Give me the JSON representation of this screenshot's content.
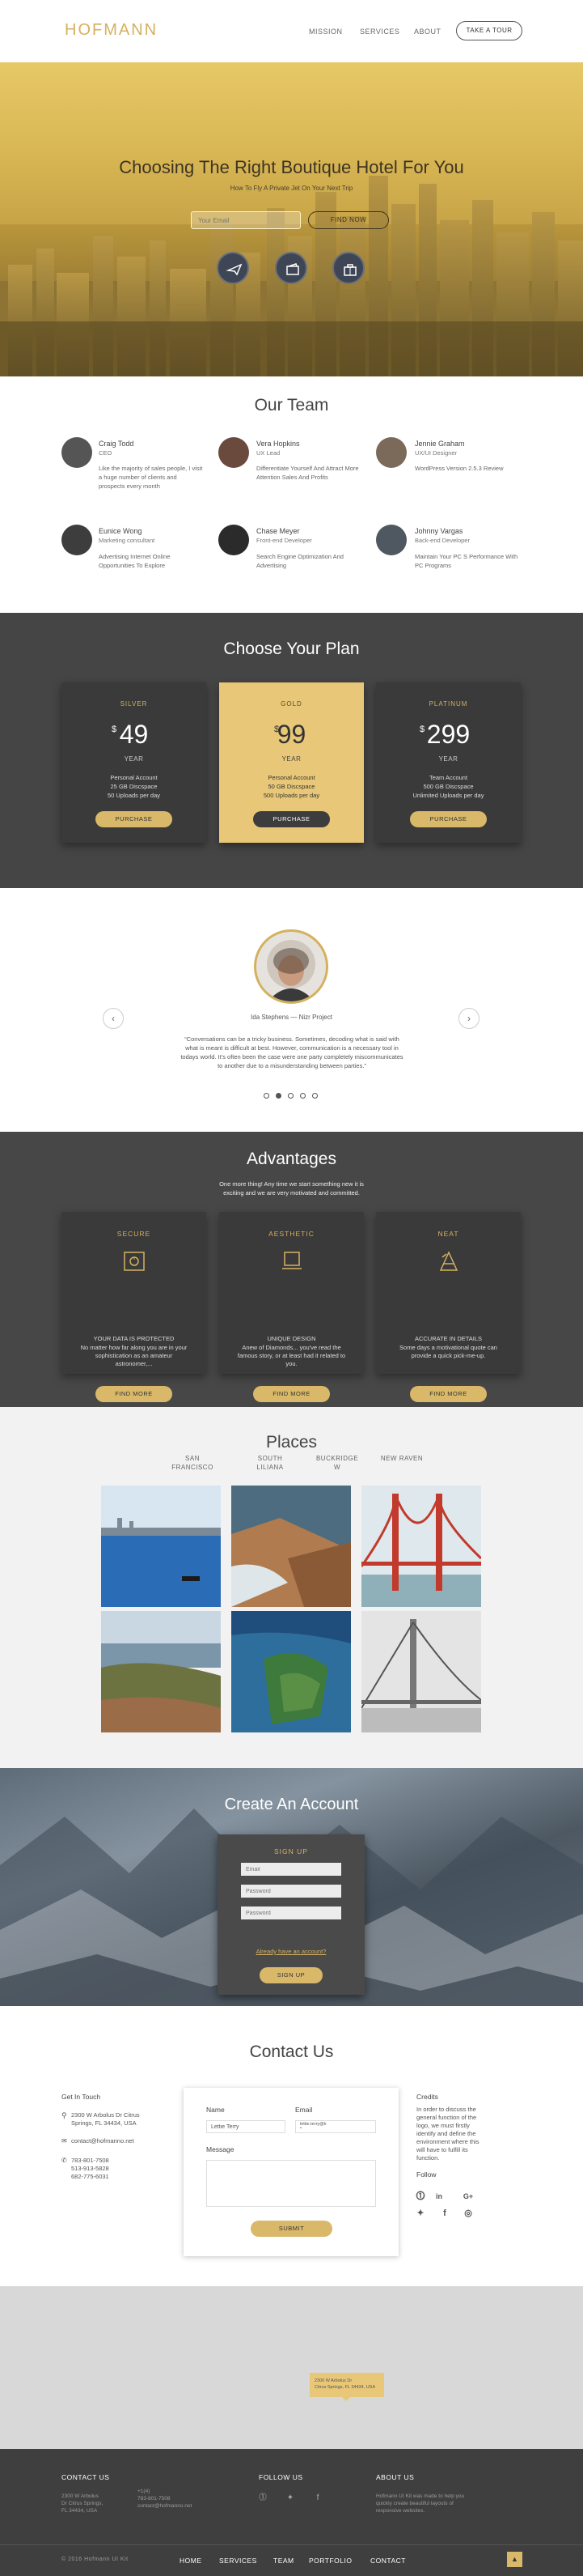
{
  "header": {
    "logo": "HOFMANN",
    "nav": [
      "MISSION",
      "SERVICES",
      "ABOUT"
    ],
    "tour_btn": "TAKE A TOUR"
  },
  "hero": {
    "title": "Choosing The Right Boutique Hotel For You",
    "subtitle": "How To Fly A Private Jet On Your Next Trip",
    "email_placeholder": "Your Email",
    "find_btn": "FIND NOW",
    "icons": [
      "airplane-icon",
      "wallet-icon",
      "suitcase-icon"
    ]
  },
  "team": {
    "title": "Our Team",
    "members": [
      {
        "name": "Craig Todd",
        "role": "CEO",
        "desc": "Like the majority of sales people, I visit a huge number of clients and prospects every month"
      },
      {
        "name": "Vera Hopkins",
        "role": "UX Lead",
        "desc": "Differentiate Yourself And Attract More Attention Sales And Profits"
      },
      {
        "name": "Jennie Graham",
        "role": "UX/UI Designer",
        "desc": "WordPress Version 2.5.3 Review"
      },
      {
        "name": "Eunice Wong",
        "role": "Marketing consultant",
        "desc": "Advertising Internet Online Opportunities To Explore"
      },
      {
        "name": "Chase Meyer",
        "role": "Front-end Developer",
        "desc": "Search Engine Optimization And Advertising"
      },
      {
        "name": "Johnny Vargas",
        "role": "Back-end Developer",
        "desc": "Maintain Your PC S Performance With PC Programs"
      }
    ]
  },
  "plans": {
    "title": "Choose Your Plan",
    "items": [
      {
        "name": "SILVER",
        "currency": "$",
        "price": "49",
        "period": "YEAR",
        "features": [
          "Personal Account",
          "25 GB Discspace",
          "50 Uploads per day"
        ],
        "button": "PURCHASE"
      },
      {
        "name": "GOLD",
        "currency": "$",
        "price": "99",
        "period": "YEAR",
        "features": [
          "Personal Account",
          "50 GB Discspace",
          "500 Uploads per day"
        ],
        "button": "PURCHASE"
      },
      {
        "name": "PLATINUM",
        "currency": "$",
        "price": "299",
        "period": "YEAR",
        "features": [
          "Team Account",
          "500 GB Discspace",
          "Unlimited Uploads per day"
        ],
        "button": "PURCHASE"
      }
    ]
  },
  "testimonial": {
    "name": "Ida Stephens — Nizr Project",
    "quote": "“Conversations can be a tricky business. Sometimes, decoding what is said with what is meant is difficult at best. However, communication is a necessary tool in todays world. It's often been the case were one party completely miscommunicates to another due to a misunderstanding between parties.”",
    "prev": "‹",
    "next": "›",
    "slides": 5,
    "active": 1
  },
  "advantages": {
    "title": "Advantages",
    "subtitle": "One more thing! Any time we start something new it is exciting and we are very motivated and committed.",
    "items": [
      {
        "title": "SECURE",
        "heading": "YOUR DATA IS PROTECTED",
        "desc": "No matter how far along you are in your sophistication as an amateur astronomer,...",
        "button": "FIND MORE",
        "icon": "safe-icon"
      },
      {
        "title": "AESTHETIC",
        "heading": "UNIQUE DESIGN",
        "desc": "Anew of Diamonds... you've read the famous story, or at least had it related to you.",
        "button": "FIND MORE",
        "icon": "monitor-icon"
      },
      {
        "title": "NEAT",
        "heading": "ACCURATE IN DETAILS",
        "desc": "Some days a motivational quote can provide a quick pick-me-up.",
        "button": "FIND MORE",
        "icon": "pen-tool-icon"
      }
    ]
  },
  "places": {
    "title": "Places",
    "tabs": [
      "SAN\nFRANCISCO",
      "SOUTH\nLILIANA",
      "BUCKRIDGE\nW",
      "NEW RAVEN"
    ]
  },
  "create": {
    "title": "Create An Account",
    "form_title": "SIGN UP",
    "email": "Email",
    "password": "Password",
    "password2": "Password",
    "already": "Already have an account?",
    "button": "SIGN UP"
  },
  "contact": {
    "title": "Contact Us",
    "get_in_touch": "Get In Touch",
    "address": "2300 W Arbolus Dr Citrus Springs, FL 34434, USA",
    "email": "contact@hofmanno.net",
    "phones": "783-801-7508\n513-913-5828\n682-775-6031",
    "name_label": "Name",
    "email_label": "Email",
    "name_value": "Lettie Terry",
    "email_value": "lettie.terry@k\n•",
    "message_label": "Message",
    "submit": "SUBMIT",
    "credits_title": "Credits",
    "credits_text": "In order to discuss the general function of the logo, we must firstly identify and define the environment where this will have to fulfill its function.",
    "follow": "Follow"
  },
  "map": {
    "tip": "2300 W Arbolus Dr\nCitrus Springs, FL 34434, USA"
  },
  "footer": {
    "contact_title": "CONTACT US",
    "address": "2300 W Arbolus\nDr Citrus Springs,\nFL 34434, USA",
    "phone": "+1(4)\n783-801-7508",
    "email": "contact@hofmanno.net",
    "follow_title": "FOLLOW US",
    "about_title": "ABOUT US",
    "about_text": "Hofmann UI Kit was made to help you quickly create beautiful layouts of responsive websites.",
    "copyright": "© 2016 Hofmann UI Kit",
    "nav": [
      "HOME",
      "SERVICES",
      "TEAM",
      "PORTFOLIO",
      "CONTACT"
    ],
    "totop": "▲"
  },
  "colors": {
    "accent": "#d4b15f",
    "dark": "#454545",
    "gold_card": "#e8c878"
  }
}
